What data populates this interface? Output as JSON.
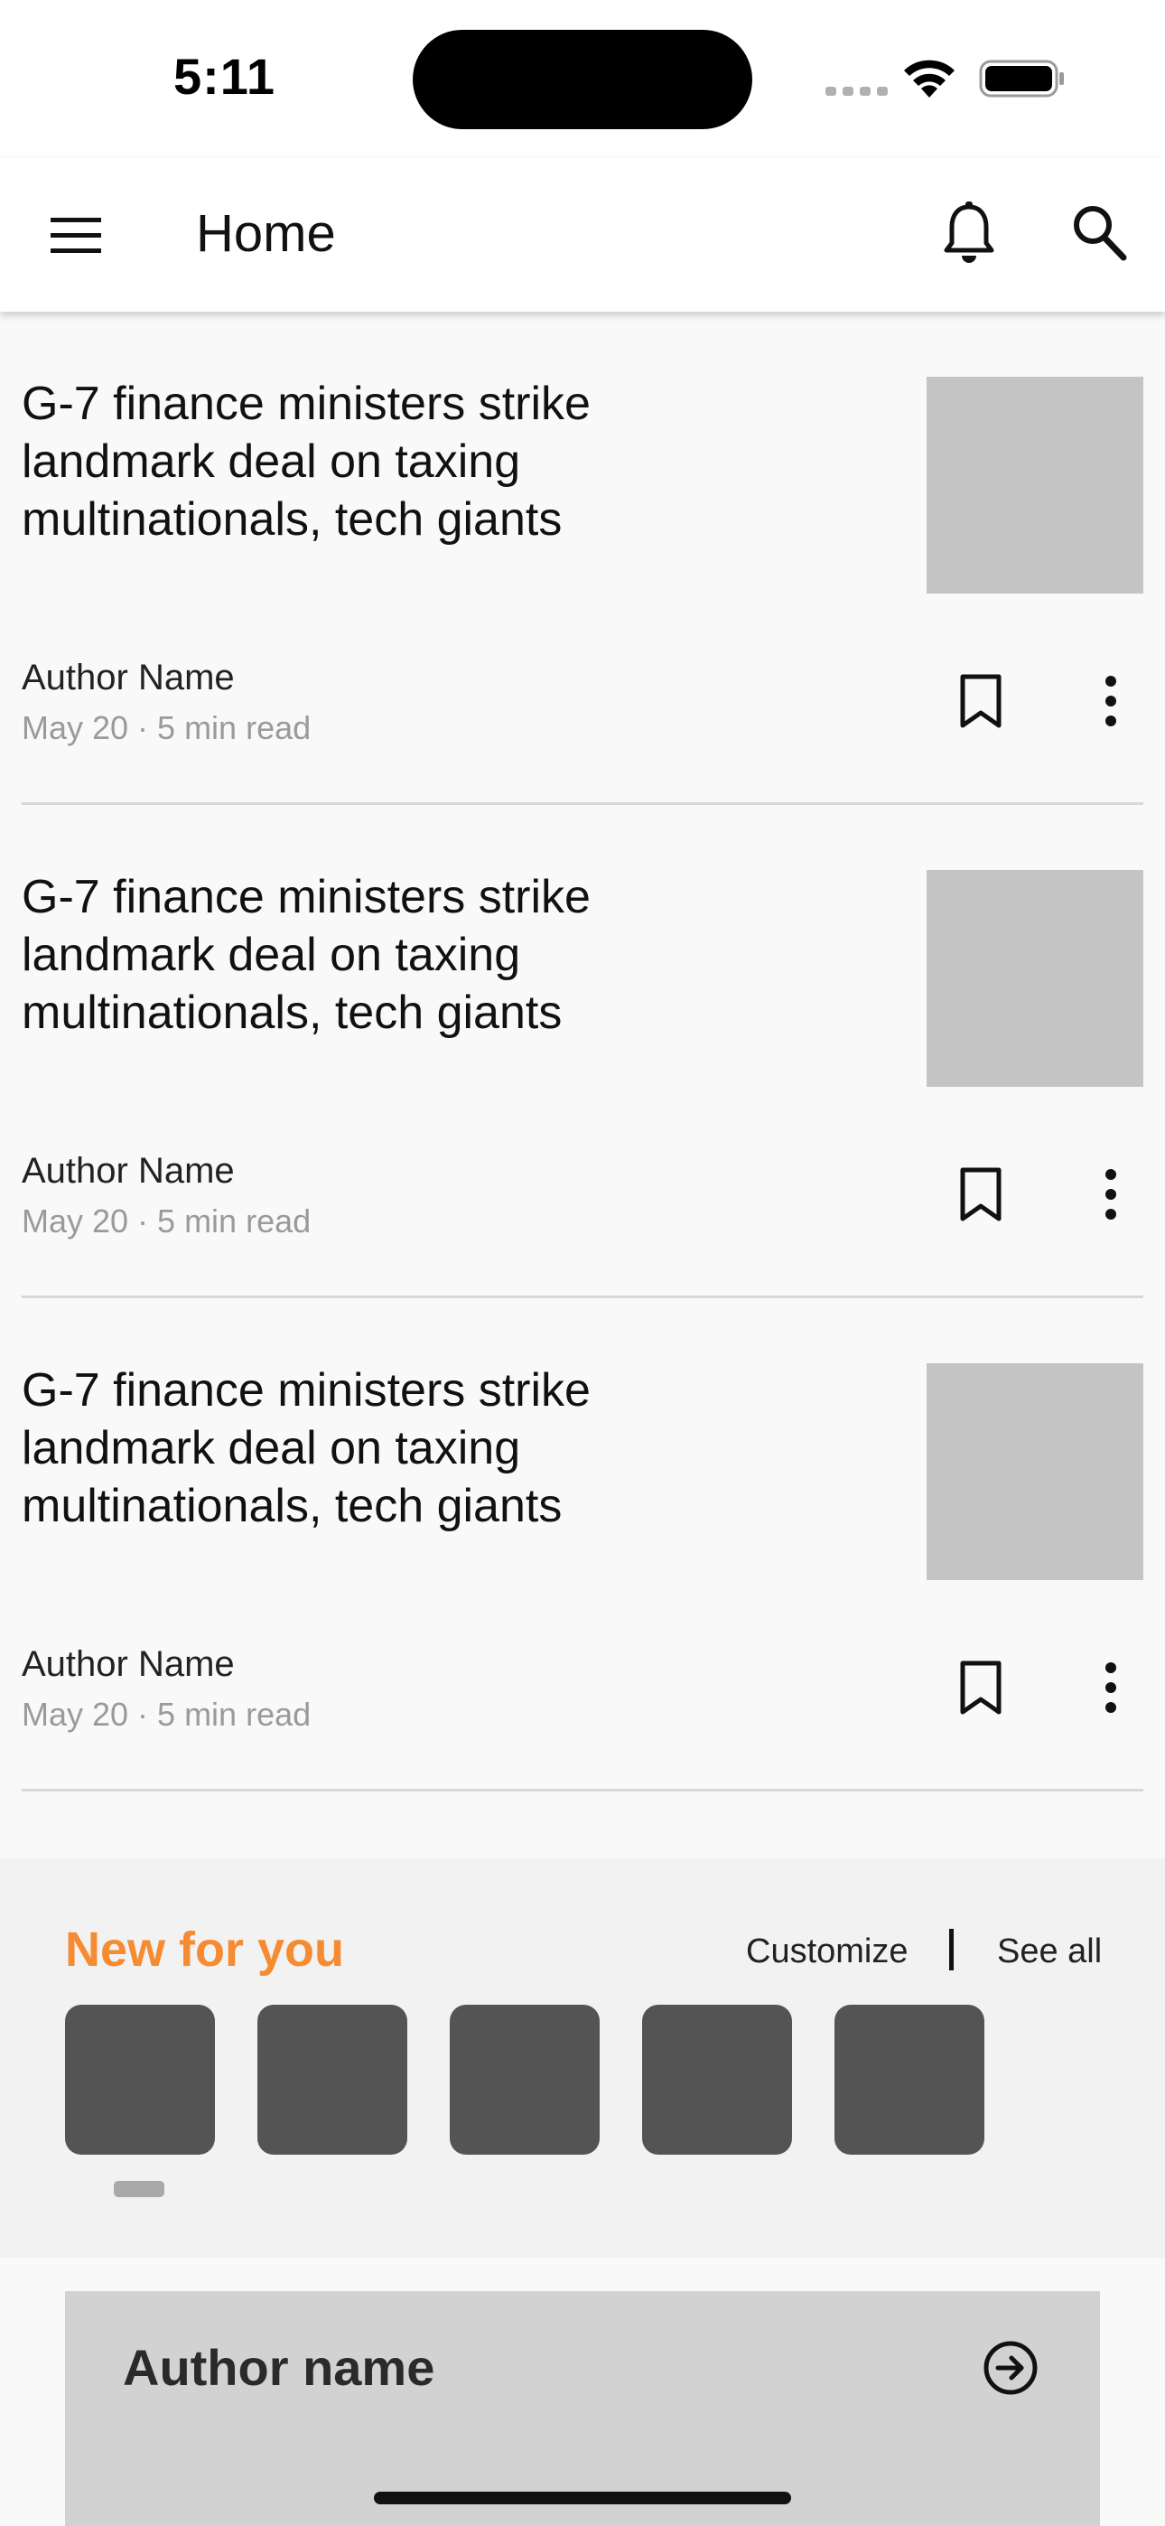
{
  "status_bar": {
    "time": "5:11",
    "icons": [
      "signal-icon",
      "wifi-icon",
      "battery-icon"
    ]
  },
  "app_bar": {
    "title": "Home",
    "left_icon": "menu-icon",
    "right_icons": [
      "bell-icon",
      "search-icon"
    ]
  },
  "articles": [
    {
      "title": "G-7 finance ministers strike landmark deal on taxing multinationals, tech giants",
      "author": "Author Name",
      "meta": "May 20 · 5 min read"
    },
    {
      "title": "G-7 finance ministers strike landmark deal on taxing multinationals, tech giants",
      "author": "Author Name",
      "meta": "May 20 · 5 min read"
    },
    {
      "title": "G-7 finance ministers strike landmark deal on taxing multinationals, tech giants",
      "author": "Author Name",
      "meta": "May 20 · 5 min read"
    }
  ],
  "new_for_you": {
    "title": "New for you",
    "customize_label": "Customize",
    "see_all_label": "See all",
    "tile_count": 5
  },
  "author_card": {
    "name": "Author name",
    "action_icon": "arrow-right-circle-icon"
  },
  "colors": {
    "accent": "#f58b32",
    "placeholder_light": "#c4c4c4",
    "placeholder_dark": "#545454",
    "background": "#f9f9f9",
    "section_background": "#f2f2f2",
    "card_background": "#d2d2d2"
  }
}
